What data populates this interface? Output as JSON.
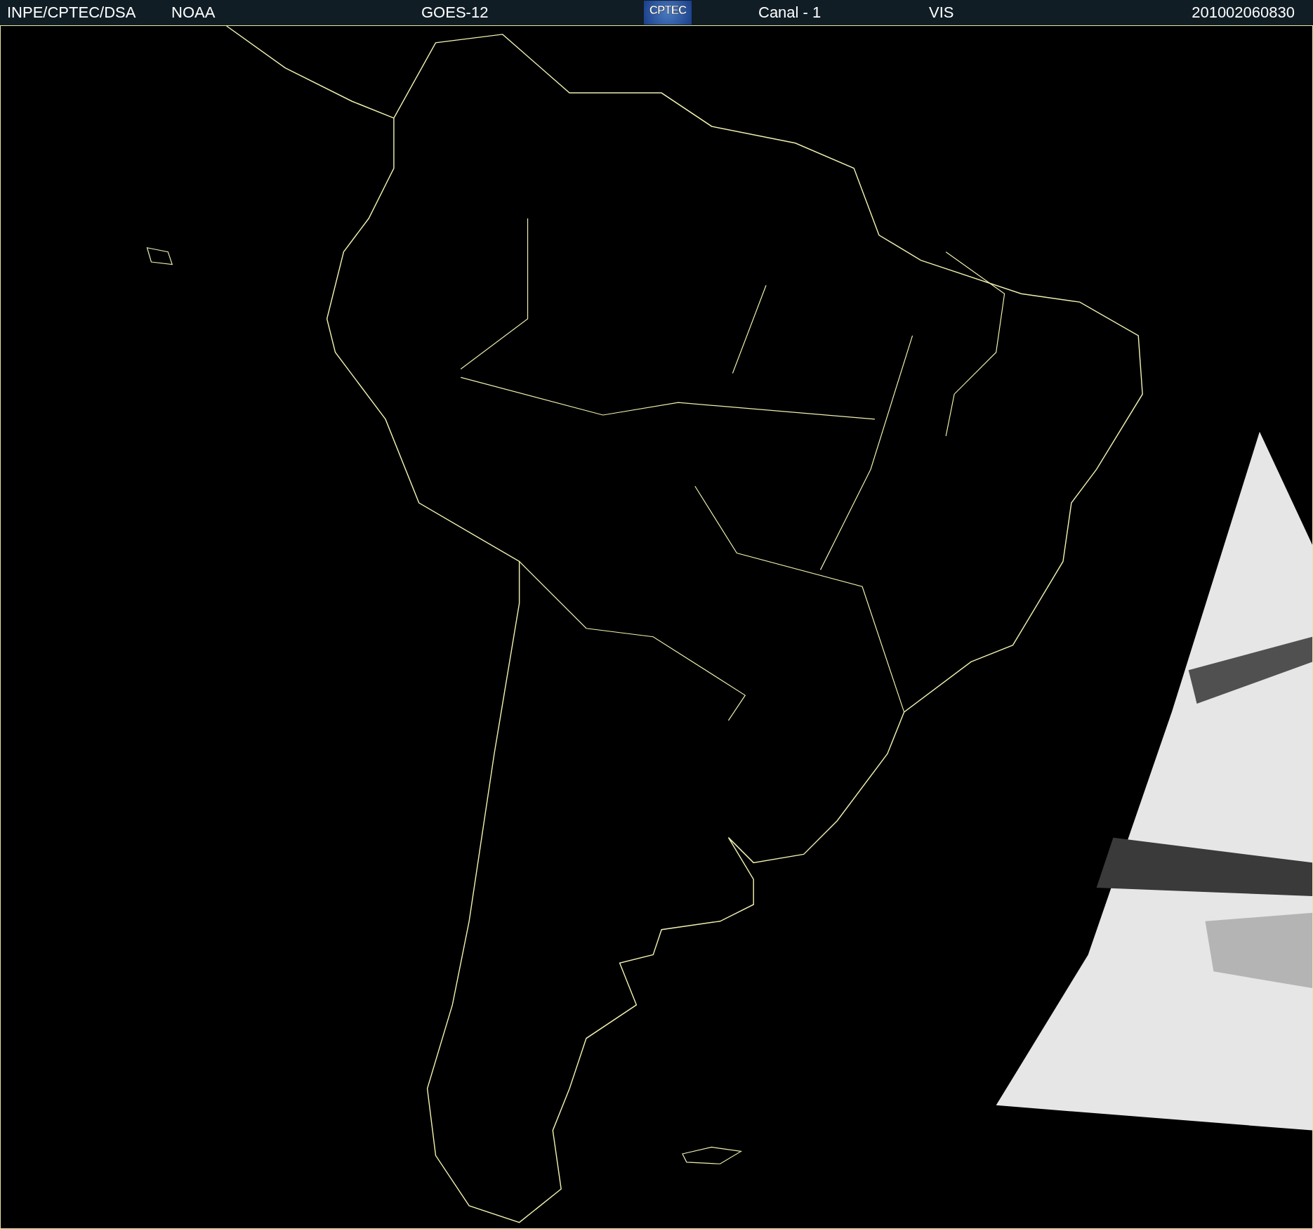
{
  "header": {
    "source": "INPE/CPTEC/DSA",
    "agency": "NOAA",
    "satellite": "GOES-12",
    "logo": "CPTEC",
    "channel": "Canal - 1",
    "band": "VIS",
    "timestamp": "201002060830"
  }
}
